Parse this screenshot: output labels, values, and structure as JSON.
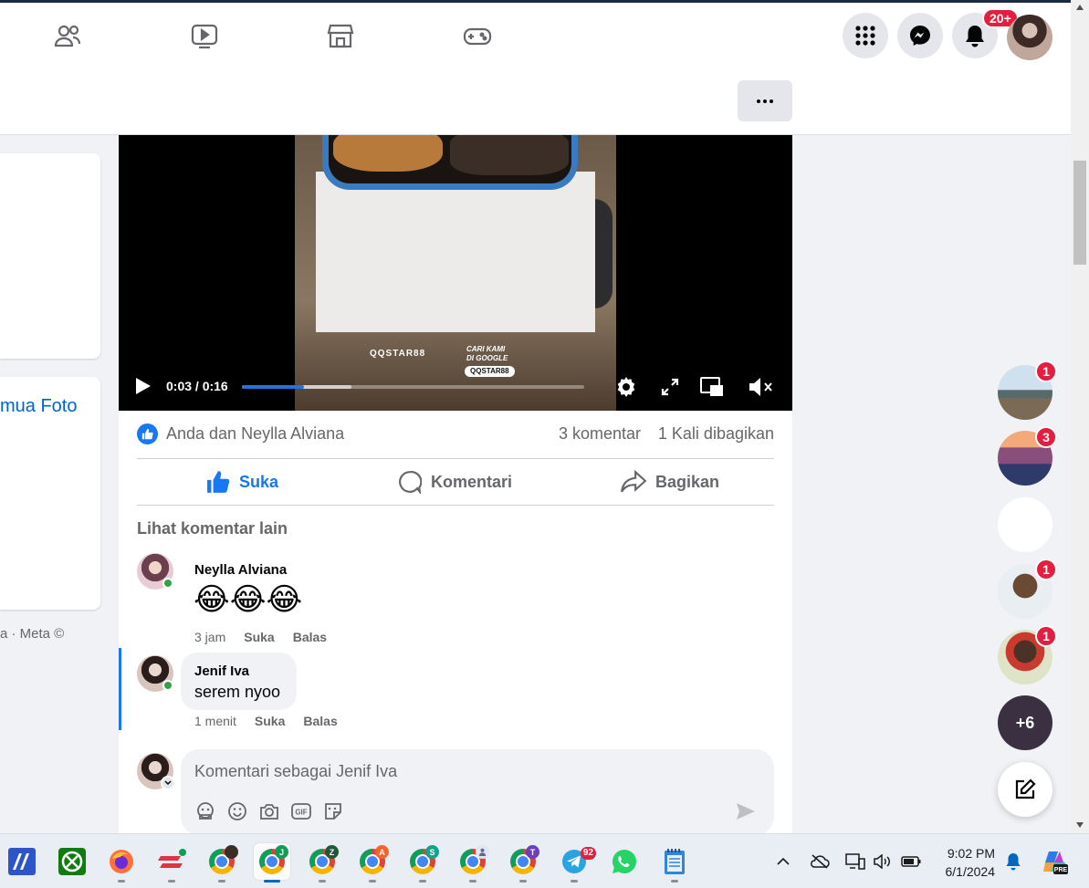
{
  "nav": {
    "notifications_badge": "20+",
    "icons": [
      "friends-icon",
      "watch-icon",
      "marketplace-icon",
      "gaming-icon",
      "menu-grid-icon",
      "messenger-icon",
      "bell-icon"
    ]
  },
  "left": {
    "see_photos": "mua Foto",
    "footer": "a · Meta ©"
  },
  "video": {
    "time": "0:03 / 0:16",
    "progress_fraction": 0.18,
    "buffered_fraction": 0.32,
    "watermark": "QQSTAR88",
    "promo_line1": "CARI KAMI",
    "promo_line2": "DI GOOGLE",
    "promo_tag": "QQSTAR88"
  },
  "post": {
    "reaction_names": "Anda dan Neylla Alviana",
    "comment_count": "3 komentar",
    "share_count": "1 Kali dibagikan",
    "like_label": "Suka",
    "comment_label": "Komentari",
    "share_label": "Bagikan",
    "more_comments": "Lihat komentar lain"
  },
  "comments": [
    {
      "name": "Neylla Alviana",
      "text": "😂😂😂",
      "time": "3 jam",
      "like": "Suka",
      "reply": "Balas"
    },
    {
      "name": "Jenif Iva",
      "text": "serem nyoo",
      "time": "1 menit",
      "like": "Suka",
      "reply": "Balas"
    }
  ],
  "composer": {
    "placeholder": "Komentari sebagai Jenif Iva"
  },
  "chats": {
    "badges": [
      "1",
      "3",
      "1",
      "1"
    ],
    "more": "+6"
  },
  "taskbar": {
    "telegram_badge": "92",
    "chrome_profiles": [
      "J",
      "Z",
      "A",
      "S",
      "T"
    ],
    "time": "9:02 PM",
    "date": "6/1/2024"
  },
  "colors": {
    "accent": "#1877f2",
    "badge": "#e41e3f",
    "online": "#31a24c"
  }
}
